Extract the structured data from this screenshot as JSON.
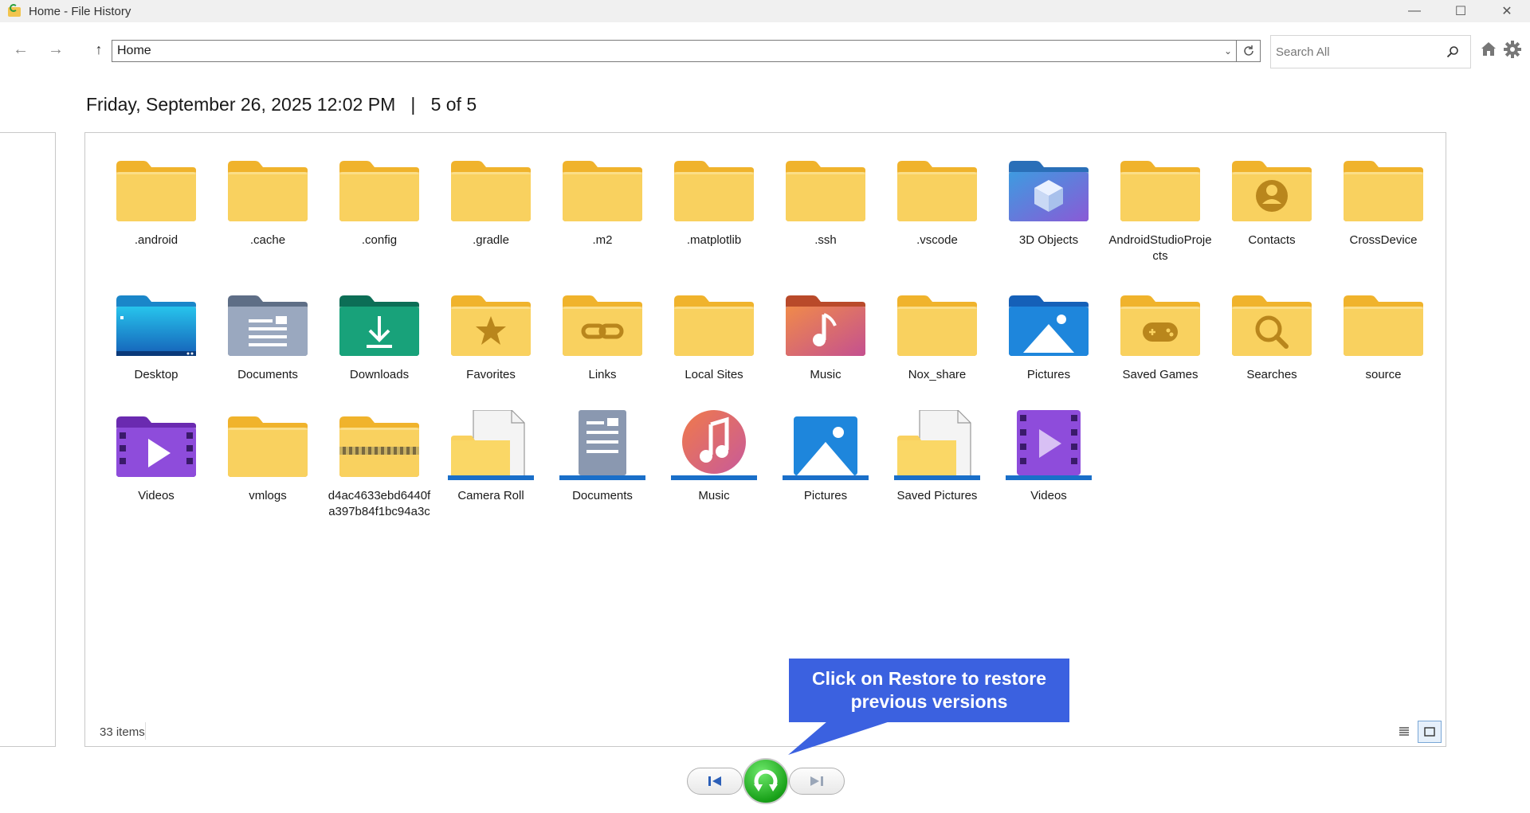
{
  "window": {
    "title": "Home - File History",
    "minimize": "—",
    "maximize": "☐",
    "close": "✕"
  },
  "nav": {
    "back": "←",
    "forward": "→",
    "up": "↑",
    "address": "Home",
    "search_placeholder": "Search All"
  },
  "heading": {
    "date": "Friday, September 26, 2025 12:02 PM",
    "separator": "|",
    "position": "5 of 5"
  },
  "items": [
    {
      "label": ".android",
      "icon": "folder-icon"
    },
    {
      "label": ".cache",
      "icon": "folder-icon"
    },
    {
      "label": ".config",
      "icon": "folder-icon"
    },
    {
      "label": ".gradle",
      "icon": "folder-icon"
    },
    {
      "label": ".m2",
      "icon": "folder-icon"
    },
    {
      "label": ".matplotlib",
      "icon": "folder-icon"
    },
    {
      "label": ".ssh",
      "icon": "folder-icon"
    },
    {
      "label": ".vscode",
      "icon": "folder-icon"
    },
    {
      "label": "3D Objects",
      "icon": "3d-objects-folder-icon"
    },
    {
      "label": "AndroidStudioProjects",
      "icon": "folder-icon"
    },
    {
      "label": "Contacts",
      "icon": "contacts-folder-icon"
    },
    {
      "label": "CrossDevice",
      "icon": "folder-icon"
    },
    {
      "label": "Desktop",
      "icon": "desktop-folder-icon"
    },
    {
      "label": "Documents",
      "icon": "documents-folder-icon"
    },
    {
      "label": "Downloads",
      "icon": "downloads-folder-icon"
    },
    {
      "label": "Favorites",
      "icon": "favorites-folder-icon"
    },
    {
      "label": "Links",
      "icon": "links-folder-icon"
    },
    {
      "label": "Local Sites",
      "icon": "folder-icon"
    },
    {
      "label": "Music",
      "icon": "music-folder-icon"
    },
    {
      "label": "Nox_share",
      "icon": "folder-icon"
    },
    {
      "label": "Pictures",
      "icon": "pictures-folder-icon"
    },
    {
      "label": "Saved Games",
      "icon": "saved-games-folder-icon"
    },
    {
      "label": "Searches",
      "icon": "searches-folder-icon"
    },
    {
      "label": "source",
      "icon": "folder-icon"
    },
    {
      "label": "Videos",
      "icon": "videos-folder-icon"
    },
    {
      "label": "vmlogs",
      "icon": "folder-icon"
    },
    {
      "label": "d4ac4633ebd6440fa397b84f1bc94a3c",
      "icon": "zip-folder-icon"
    },
    {
      "label": "Camera Roll",
      "icon": "camera-roll-library-icon"
    },
    {
      "label": "Documents",
      "icon": "documents-library-icon"
    },
    {
      "label": "Music",
      "icon": "music-library-icon"
    },
    {
      "label": "Pictures",
      "icon": "pictures-library-icon"
    },
    {
      "label": "Saved Pictures",
      "icon": "saved-pictures-library-icon"
    },
    {
      "label": "Videos",
      "icon": "videos-library-icon"
    }
  ],
  "status": {
    "item_count": "33 items"
  },
  "tooltip": {
    "text": "Click on Restore to restore previous versions"
  },
  "colors": {
    "folder": "#f7cb57",
    "folder_tab": "#f2b52e",
    "tooltip": "#3b61e0",
    "restore": "#1aa21a"
  }
}
